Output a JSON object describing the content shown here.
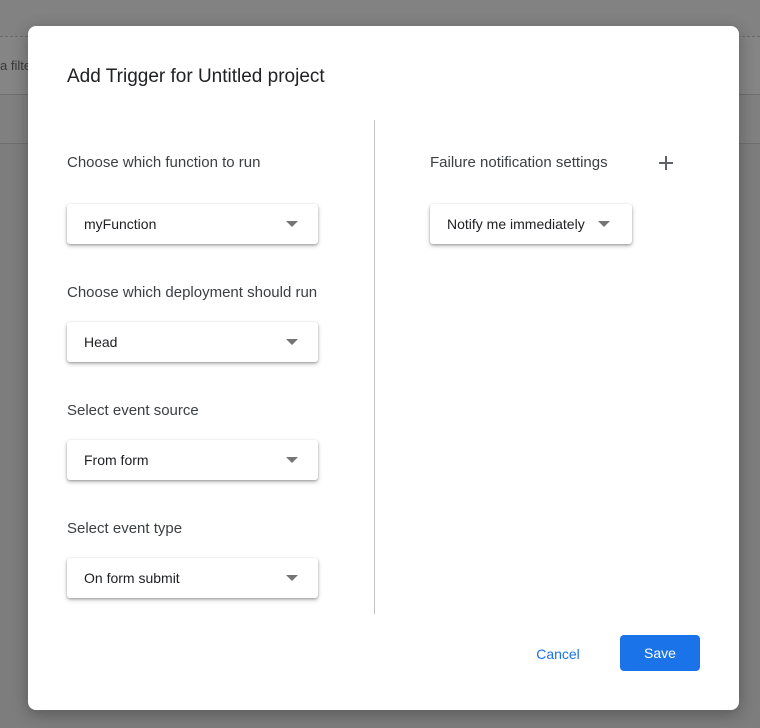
{
  "background": {
    "filter_text": "a filte"
  },
  "dialog": {
    "title": "Add Trigger for Untitled project",
    "fields": [
      {
        "label": "Choose which function to run",
        "value": "myFunction"
      },
      {
        "label": "Choose which deployment should run",
        "value": "Head"
      },
      {
        "label": "Select event source",
        "value": "From form"
      },
      {
        "label": "Select event type",
        "value": "On form submit"
      }
    ],
    "failure": {
      "label": "Failure notification settings",
      "value": "Notify me immediately",
      "add_icon": "plus-icon"
    },
    "cancel_label": "Cancel",
    "save_label": "Save"
  },
  "colors": {
    "accent": "#1a73e8",
    "overlay": "#7d7d7d",
    "text": "#3c4043"
  }
}
